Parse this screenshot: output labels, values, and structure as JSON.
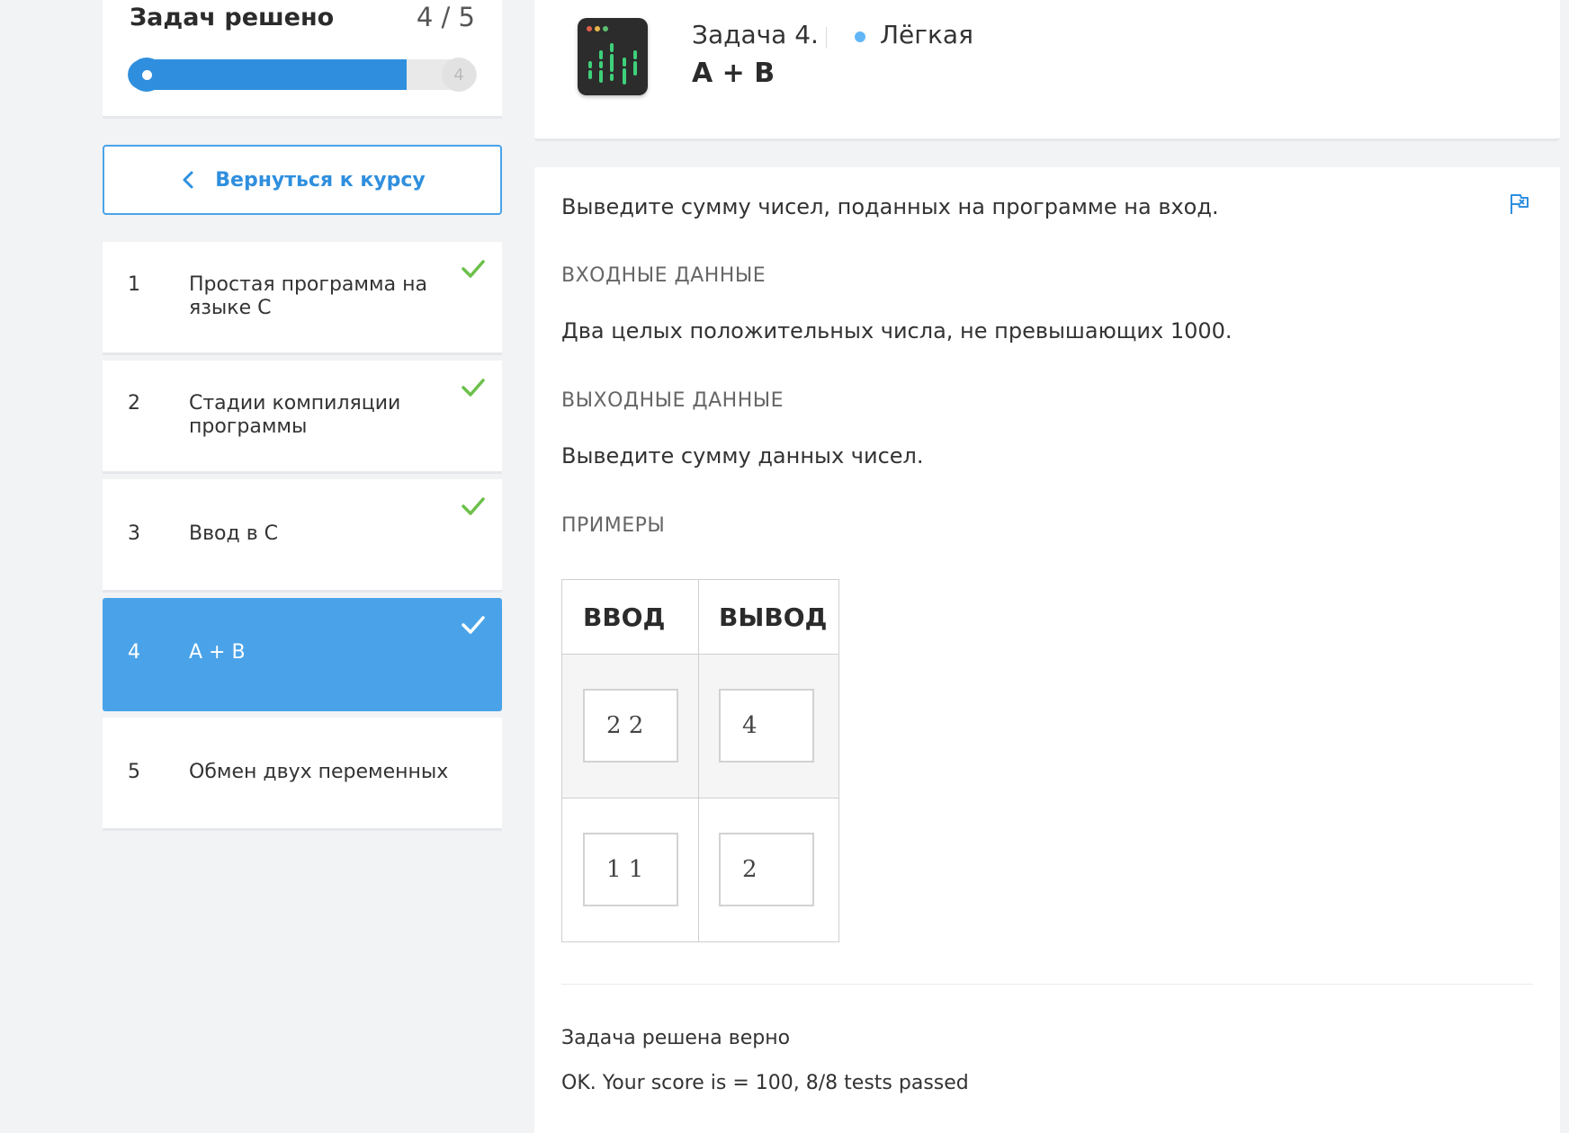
{
  "sidebar": {
    "progress": {
      "title": "Задач решено",
      "count": "4 / 5",
      "end_marker": "4",
      "fraction": 0.8
    },
    "back_button": "Вернуться к курсу",
    "tasks": [
      {
        "num": "1",
        "label": "Простая программа на языке C",
        "solved": true
      },
      {
        "num": "2",
        "label": "Стадии компиляции программы",
        "solved": true
      },
      {
        "num": "3",
        "label": "Ввод в C",
        "solved": true
      },
      {
        "num": "4",
        "label": "A + B",
        "solved": true,
        "active": true
      },
      {
        "num": "5",
        "label": "Обмен двух переменных",
        "solved": false
      }
    ]
  },
  "header": {
    "task_number": "Задача 4.",
    "difficulty": "Лёгкая",
    "title": "A + B",
    "logo_icon": "terminal-equalizer-icon"
  },
  "content": {
    "statement": "Выведите сумму чисел, поданных на программе на вход.",
    "input_head": "ВХОДНЫЕ ДАННЫЕ",
    "input_text": "Два целых положительных числа, не превышающих 1000.",
    "output_head": "ВЫХОДНЫЕ ДАННЫЕ",
    "output_text": "Выведите сумму данных чисел.",
    "examples_head": "ПРИМЕРЫ",
    "examples": {
      "col_input": "ВВОД",
      "col_output": "ВЫВОД",
      "rows": [
        {
          "input": "2 2",
          "output": "4"
        },
        {
          "input": "1 1",
          "output": "2"
        }
      ]
    },
    "result_title": "Задача решена верно",
    "result_text": "OK. Your score is = 100, 8/8 tests passed"
  },
  "colors": {
    "accent": "#2f8fde",
    "active_item": "#4aa3e8",
    "check_green": "#6cc04a",
    "difficulty_dot": "#62b6f5"
  }
}
